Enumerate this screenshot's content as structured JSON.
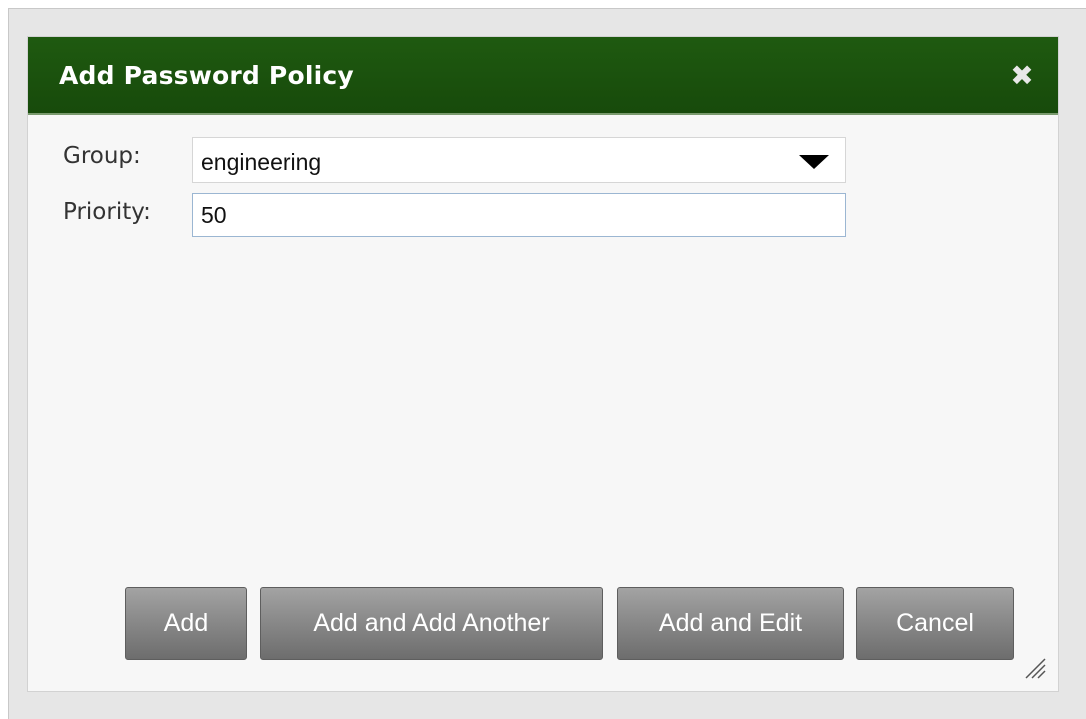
{
  "dialog": {
    "title": "Add Password Policy",
    "close_icon": "close-icon"
  },
  "form": {
    "group_label": "Group:",
    "group_value": "engineering",
    "priority_label": "Priority:",
    "priority_value": "50"
  },
  "buttons": {
    "add": "Add",
    "add_another": "Add and Add Another",
    "add_edit": "Add and Edit",
    "cancel": "Cancel"
  },
  "colors": {
    "titlebar": "#1f5a10",
    "button": "#8a8a8a"
  }
}
